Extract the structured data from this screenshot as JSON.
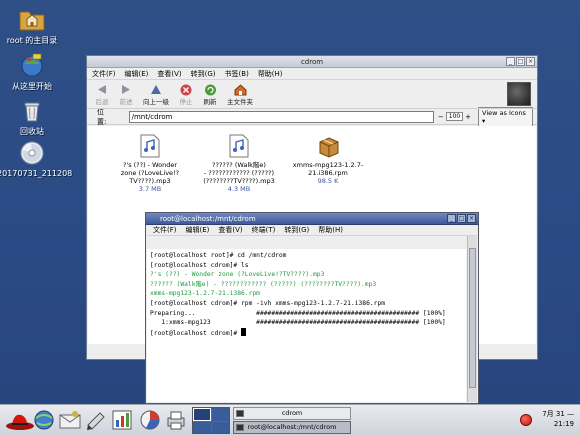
{
  "desktop": {
    "icons": [
      {
        "id": "home",
        "label": "root 的主目录",
        "icon": "folder-home-icon"
      },
      {
        "id": "start",
        "label": "从这里开始",
        "icon": "start-here-icon"
      },
      {
        "id": "trash",
        "label": "回收站",
        "icon": "trash-icon"
      },
      {
        "id": "cd",
        "label": "20170731_211208",
        "icon": "cdrom-icon"
      }
    ]
  },
  "nautilus": {
    "title": "cdrom",
    "menu": [
      "文件(F)",
      "编辑(E)",
      "查看(V)",
      "转到(G)",
      "书签(B)",
      "帮助(H)"
    ],
    "toolbar": {
      "back": "后退",
      "forward": "前进",
      "up": "向上一级",
      "stop": "停止",
      "reload": "刷新",
      "home": "主文件夹"
    },
    "location_label": "位置:",
    "location_value": "/mnt/cdrom",
    "zoom_value": "100",
    "zoom_minus": "−",
    "zoom_plus": "+",
    "view_as": "View as Icons",
    "files": [
      {
        "name1": "?'s (??) - Wonder",
        "name2": "zone (?LoveLive!?",
        "name3": "TV????).mp3",
        "size": "3.7 MB",
        "icon": "music-file-icon"
      },
      {
        "name1": "?????? (Walk階e)",
        "name2": "- ???????????? (?????)",
        "name3": "(????????TV????).mp3",
        "size": "4.3 MB",
        "icon": "music-file-icon"
      },
      {
        "name1": "xmms-mpg123-1.2.7-",
        "name2": "21.i386.rpm",
        "name3": "",
        "size": "98.5 K",
        "icon": "package-icon"
      }
    ]
  },
  "terminal": {
    "title": "root@localhost:/mnt/cdrom",
    "menu": [
      "文件(F)",
      "编辑(E)",
      "查看(V)",
      "终端(T)",
      "转到(G)",
      "帮助(H)"
    ],
    "lines": [
      {
        "text": "[root@localhost root]# cd /mnt/cdrom",
        "color": "#000000"
      },
      {
        "text": "[root@localhost cdrom]# ls",
        "color": "#000000"
      },
      {
        "text": "?'s (??) - Wonder zone (?LoveLive!?TV????).mp3",
        "color": "#1b9a3a"
      },
      {
        "text": "?????? (Walk階e) - ???????????? (?????) (????????TV????).mp3",
        "color": "#1b9a3a"
      },
      {
        "text": "xmms-mpg123-1.2.7-21.i386.rpm",
        "color": "#1b9a3a"
      },
      {
        "text": "[root@localhost cdrom]# rpm -ivh xmms-mpg123-1.2.7-21.i386.rpm",
        "color": "#000000"
      },
      {
        "text": "Preparing...                ########################################### [100%]",
        "color": "#000000"
      },
      {
        "text": "   1:xmms-mpg123            ########################################### [100%]",
        "color": "#000000"
      },
      {
        "text": "[root@localhost cdrom]# ",
        "color": "#000000"
      }
    ]
  },
  "panel": {
    "tasks": [
      {
        "label": "cdrom",
        "active": false
      },
      {
        "label": "root@localhost:/mnt/cdrom",
        "active": true
      }
    ],
    "clock_date": "7月 31 —",
    "clock_time": "21:19"
  },
  "colors": {
    "desktop_bg": "#2a4a85",
    "terminal_green": "#1b9a3a",
    "file_size": "#3a57a6"
  }
}
